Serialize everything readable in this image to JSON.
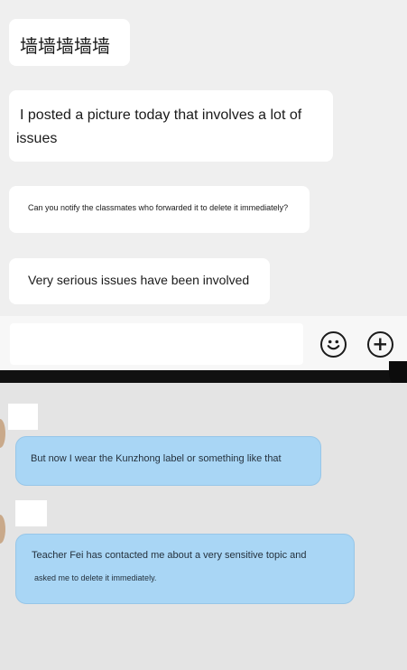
{
  "top_chat": {
    "messages": [
      {
        "text": "墙墙墙墙墙"
      },
      {
        "text": "I posted a picture today that involves a lot of issues"
      },
      {
        "text": "Can you notify the classmates who forwarded it to delete it immediately?"
      },
      {
        "text": "Very serious issues have been involved"
      }
    ],
    "input": {
      "placeholder": ""
    },
    "icons": {
      "emoji": "smiley-face-icon",
      "add": "plus-circle-icon"
    }
  },
  "bottom_chat": {
    "messages": [
      {
        "text": "But now I wear the Kunzhong label or something like that"
      },
      {
        "line1": "Teacher Fei has contacted me about a very sensitive topic and",
        "line2": "asked me to delete it immediately."
      }
    ]
  },
  "colors": {
    "top_background": "#efefef",
    "bottom_background": "#e4e4e4",
    "outgoing_bubble": "#a9d6f5",
    "incoming_bubble": "#ffffff",
    "divider": "#111111"
  }
}
